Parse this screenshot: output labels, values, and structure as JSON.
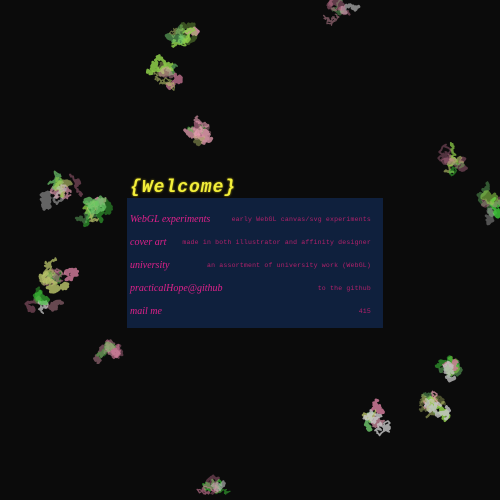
{
  "title": "{Welcome}",
  "links": [
    {
      "name": "WebGL experiments",
      "desc": "early WebGL canvas/svg experiments"
    },
    {
      "name": "cover art",
      "desc": "made in both illustrator and affinity designer"
    },
    {
      "name": "university",
      "desc": "an assortment of university work (WebGL)"
    },
    {
      "name": "practicalHope@github",
      "desc": "to the github"
    },
    {
      "name": "mail me",
      "desc": "415"
    }
  ],
  "colors": {
    "background": "#0b0b0b",
    "title": "#f3ef3a",
    "link": "#e0208a",
    "panel": "#10244a"
  }
}
